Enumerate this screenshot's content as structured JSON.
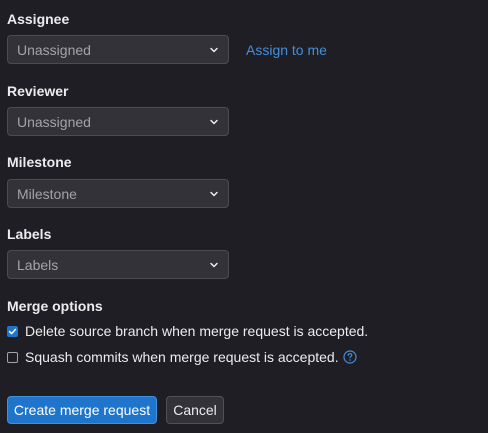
{
  "assignee": {
    "label": "Assignee",
    "value": "Unassigned",
    "assign_link": "Assign to me"
  },
  "reviewer": {
    "label": "Reviewer",
    "value": "Unassigned"
  },
  "milestone": {
    "label": "Milestone",
    "value": "Milestone"
  },
  "labels": {
    "label": "Labels",
    "value": "Labels"
  },
  "merge_options": {
    "label": "Merge options",
    "delete_source": {
      "text": "Delete source branch when merge request is accepted.",
      "checked": true
    },
    "squash": {
      "text": "Squash commits when merge request is accepted.",
      "checked": false
    }
  },
  "actions": {
    "create": "Create merge request",
    "cancel": "Cancel"
  },
  "colors": {
    "background": "#1f1e24",
    "accent": "#1f75cb",
    "link": "#428fdc"
  },
  "icons": {
    "dropdown": "chevron-down-icon",
    "check": "checkmark-icon",
    "help": "question-circle-icon"
  }
}
